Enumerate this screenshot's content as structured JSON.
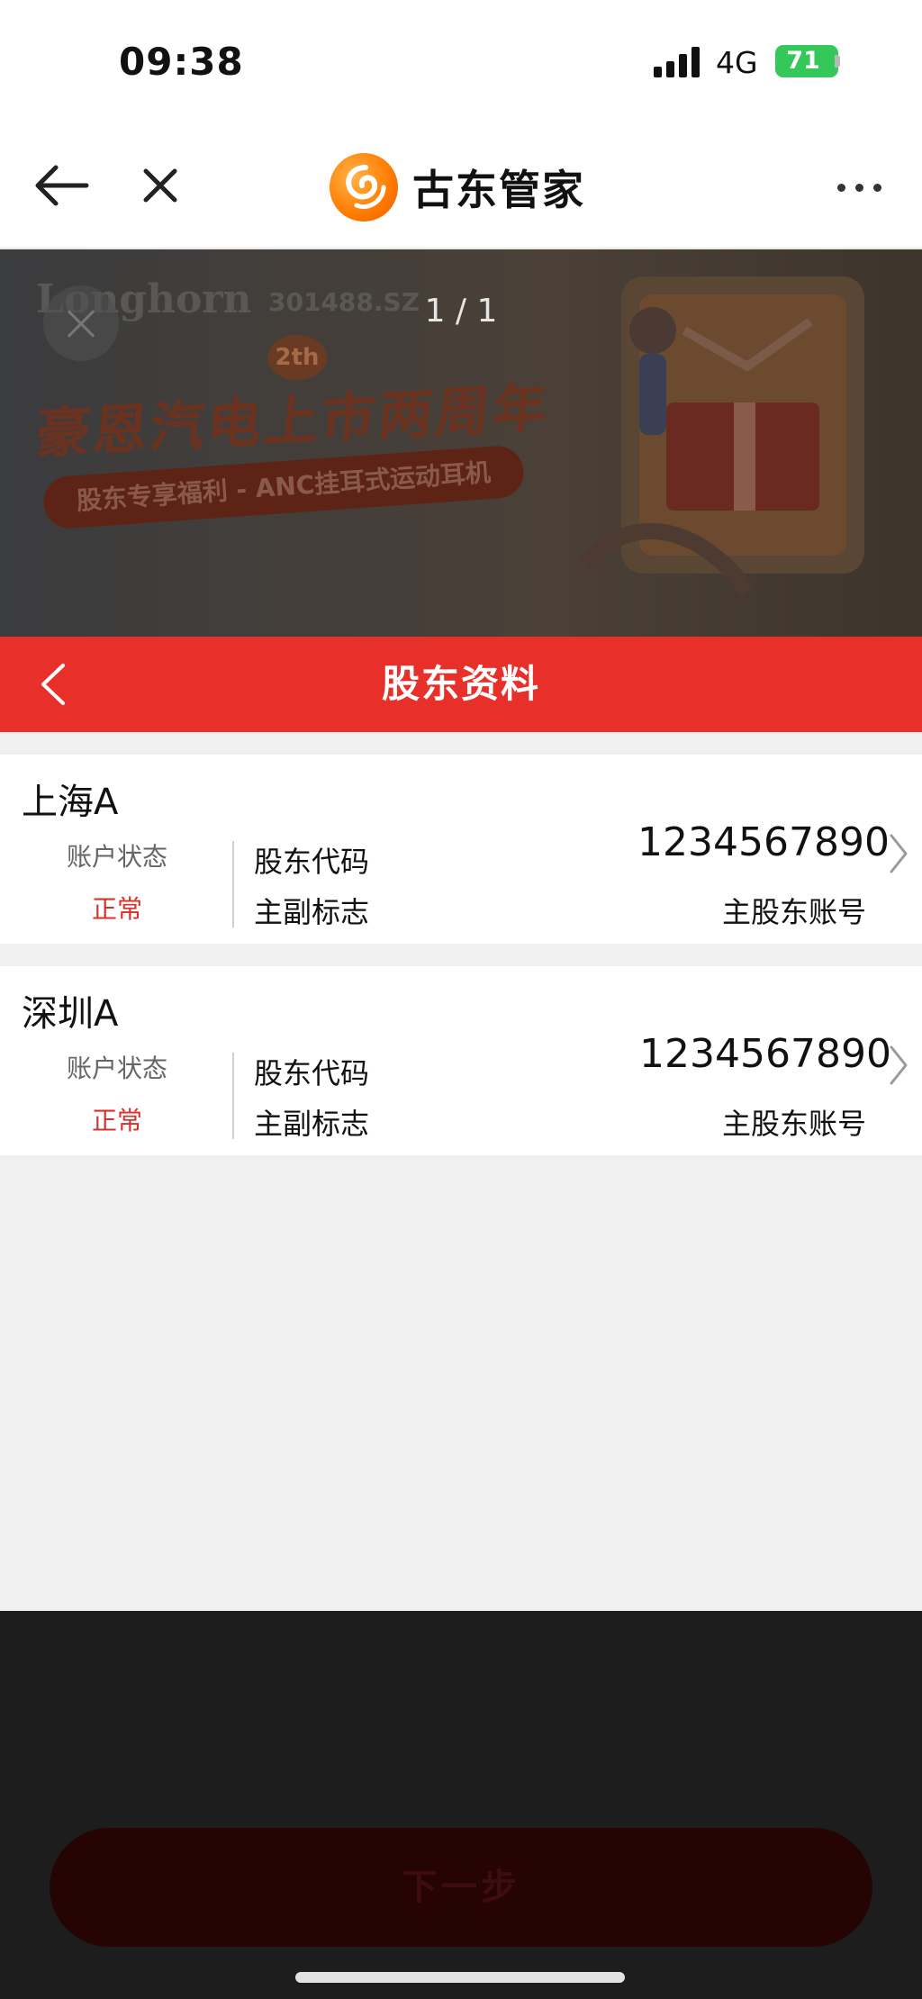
{
  "status_bar": {
    "time": "09:38",
    "network": "4G",
    "battery": "71"
  },
  "nav": {
    "title": "古东管家"
  },
  "banner": {
    "counter": "1 / 1",
    "brand": "Longhorn",
    "stock_code": "301488.SZ",
    "badge": "2th",
    "headline": "豪恩汽电上市两周年",
    "subline": "股东专享福利 - ANC挂耳式运动耳机"
  },
  "header": {
    "title": "股东资料"
  },
  "accounts": [
    {
      "market": "上海A",
      "status_label": "账户状态",
      "status": "正常",
      "code_label": "股东代码",
      "flag_label": "主副标志",
      "number": "1234567890",
      "type": "主股东账号"
    },
    {
      "market": "深圳A",
      "status_label": "账户状态",
      "status": "正常",
      "code_label": "股东代码",
      "flag_label": "主副标志",
      "number": "1234567890",
      "type": "主股东账号"
    }
  ],
  "footer": {
    "next_label": "下一步"
  },
  "colors": {
    "accent_red": "#e8302b",
    "status_red": "#d9302a",
    "battery_green": "#34c759"
  }
}
